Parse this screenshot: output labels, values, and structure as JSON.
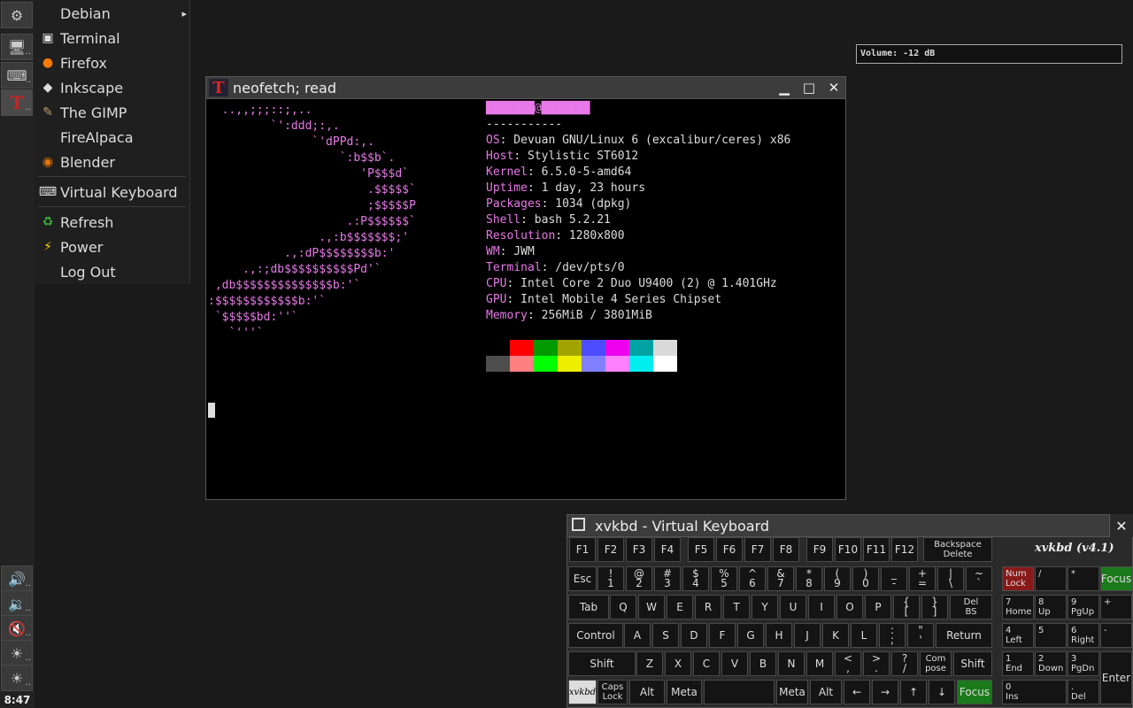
{
  "taskbar": {
    "clock": "8:47",
    "top_buttons": [
      {
        "name": "settings-gear-icon",
        "glyph": "⚙"
      },
      {
        "name": "monitor-icon",
        "glyph": "🖥"
      },
      {
        "name": "keyboard-icon",
        "glyph": "⌨"
      },
      {
        "name": "terminal-app-icon",
        "glyph": "T"
      }
    ],
    "bottom_buttons": [
      {
        "name": "volume-up-icon",
        "glyph": "🔊"
      },
      {
        "name": "volume-down-icon",
        "glyph": "🔉"
      },
      {
        "name": "mute-icon",
        "glyph": "🔇"
      },
      {
        "name": "brightness-up-icon",
        "glyph": "☀"
      },
      {
        "name": "brightness-down-icon",
        "glyph": "☀"
      }
    ],
    "dots": ".."
  },
  "menu": {
    "items": [
      {
        "label": "Debian",
        "icon": "",
        "submenu": "▸"
      },
      {
        "label": "Terminal",
        "icon": "▣"
      },
      {
        "label": "Firefox",
        "icon": "●"
      },
      {
        "label": "Inkscape",
        "icon": "◆"
      },
      {
        "label": "The GIMP",
        "icon": "✎"
      },
      {
        "label": "FireAlpaca",
        "icon": ""
      },
      {
        "label": "Blender",
        "icon": "◉"
      },
      {
        "label": "Virtual Keyboard",
        "icon": "⌨"
      },
      {
        "label": "Refresh",
        "icon": "♻"
      },
      {
        "label": "Power",
        "icon": "⚡"
      },
      {
        "label": "Log Out",
        "icon": ""
      }
    ]
  },
  "volume": {
    "text": "Volume: -12 dB"
  },
  "terminal": {
    "title": "neofetch; read",
    "icon": "T",
    "controls": {
      "minimize": "▁",
      "maximize": "□",
      "close": "✕"
    },
    "ascii_art": [
      "  ..,,;;;::;,..",
      "         `':ddd;:,.",
      "               `'dPPd:,.",
      "                   `:b$$b`.",
      "                      'P$$$d`",
      "                       .$$$$$`",
      "                       ;$$$$$P",
      "                    .:P$$$$$$`",
      "                .,:b$$$$$$$;'",
      "           .,:dP$$$$$$$$b:'",
      "     .,:;db$$$$$$$$$$Pd'`",
      " ,db$$$$$$$$$$$$$$b:'`",
      ":$$$$$$$$$$$$b:'`",
      " `$$$$$bd:''`",
      "   `'''`"
    ],
    "user_host": "███████@███████",
    "divider": "-----------",
    "info": [
      {
        "key": "OS",
        "value": "Devuan GNU/Linux 6 (excalibur/ceres) x86"
      },
      {
        "key": "Host",
        "value": "Stylistic ST6012"
      },
      {
        "key": "Kernel",
        "value": "6.5.0-5-amd64"
      },
      {
        "key": "Uptime",
        "value": "1 day, 23 hours"
      },
      {
        "key": "Packages",
        "value": "1034 (dpkg)"
      },
      {
        "key": "Shell",
        "value": "bash 5.2.21"
      },
      {
        "key": "Resolution",
        "value": "1280x800"
      },
      {
        "key": "WM",
        "value": "JWM"
      },
      {
        "key": "Terminal",
        "value": "/dev/pts/0"
      },
      {
        "key": "CPU",
        "value": "Intel Core 2 Duo U9400 (2) @ 1.401GHz"
      },
      {
        "key": "GPU",
        "value": "Intel Mobile 4 Series Chipset"
      },
      {
        "key": "Memory",
        "value": "256MiB / 3801MiB"
      }
    ],
    "palette_row1": [
      "#000000",
      "#ff0000",
      "#009900",
      "#a3a300",
      "#4d4dff",
      "#ee00ee",
      "#00a3a3",
      "#d9d9d9"
    ],
    "palette_row2": [
      "#4d4d4d",
      "#ff8080",
      "#00ff00",
      "#eeee00",
      "#8080ff",
      "#ff80ff",
      "#00eeee",
      "#ffffff"
    ],
    "accent_color": "#e879e8"
  },
  "keyboard": {
    "title": "xvkbd - Virtual Keyboard",
    "brand": "xvkbd (v4.1)",
    "close": "✕",
    "logo": "xvkbd"
  }
}
